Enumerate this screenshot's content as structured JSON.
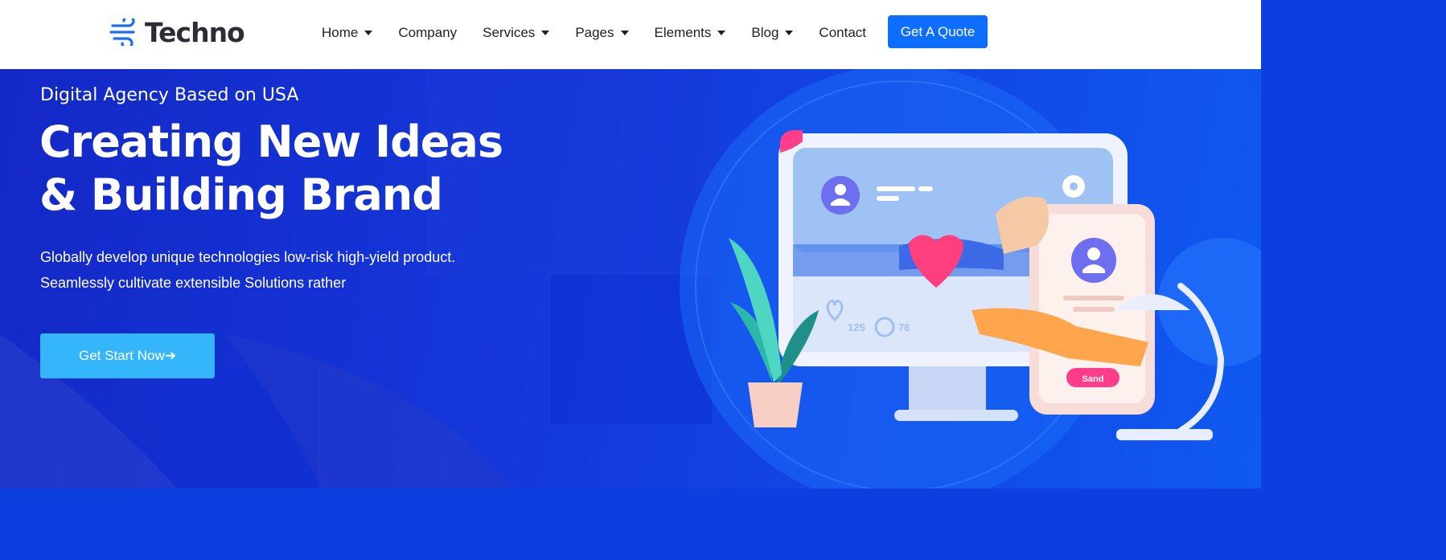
{
  "brand": {
    "name": "Techno"
  },
  "nav": {
    "items": [
      {
        "label": "Home",
        "dropdown": true
      },
      {
        "label": "Company",
        "dropdown": false
      },
      {
        "label": "Services",
        "dropdown": true
      },
      {
        "label": "Pages",
        "dropdown": true
      },
      {
        "label": "Elements",
        "dropdown": true
      },
      {
        "label": "Blog",
        "dropdown": true
      },
      {
        "label": "Contact",
        "dropdown": false
      }
    ],
    "cta_label": "Get A Quote"
  },
  "hero": {
    "tagline": "Digital Agency Based on USA",
    "headline_line1": "Creating New Ideas",
    "headline_line2": "& Building Brand",
    "desc_line1": "Globally develop unique technologies low-risk high-yield product.",
    "desc_line2": "Seamlessly cultivate extensible Solutions rather",
    "button_label": "Get Start Now➔"
  },
  "illustration": {
    "likes": "125",
    "comments": "76",
    "phone_button": "Sand"
  },
  "colors": {
    "primary": "#0d6efd",
    "hero_bg": "#1438dc",
    "start_button": "#35b6fb"
  }
}
